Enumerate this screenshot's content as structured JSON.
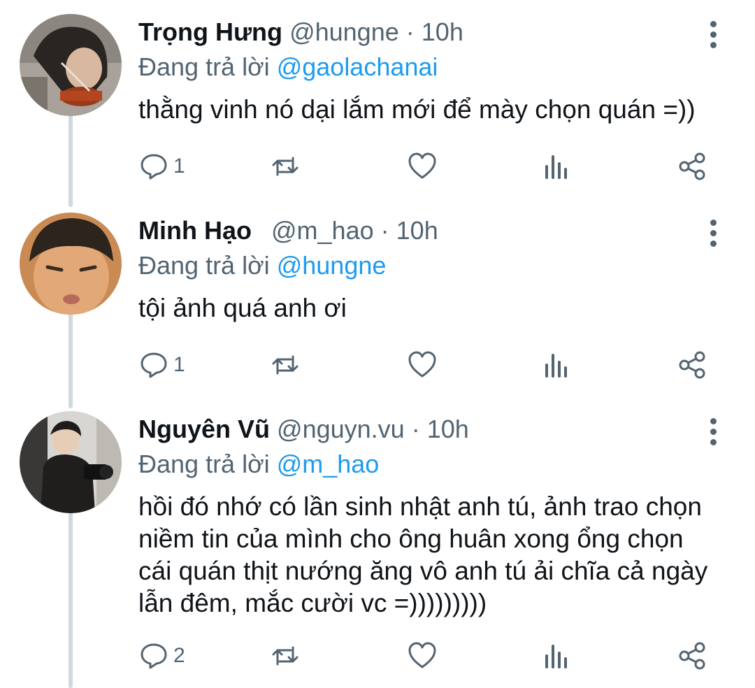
{
  "tweets": [
    {
      "name": "Trọng Hưng",
      "handle": "@hungne",
      "sep": "·",
      "time": "10h",
      "replying_prefix": "Đang trả lời",
      "replying_to": "@gaolachanai",
      "text": "thằng vinh nó dại lắm mới để mày chọn quán =))",
      "reply_count": "1"
    },
    {
      "name": "Minh Hạo",
      "handle": "@m_hao",
      "sep": "·",
      "time": "10h",
      "replying_prefix": "Đang trả lời",
      "replying_to": "@hungne",
      "text": "tội ảnh quá anh ơi",
      "reply_count": "1"
    },
    {
      "name": "Nguyên Vũ",
      "handle": "@nguyn.vu",
      "sep": "·",
      "time": "10h",
      "replying_prefix": "Đang trả lời",
      "replying_to": "@m_hao",
      "text": "hồi đó nhớ có lần sinh nhật anh tú, ảnh trao chọn niềm tin của mình cho ông huân xong ổng chọn cái quán thịt nướng ăng vô anh tú ải chĩa cả ngày lẫn đêm, mắc cười vc =)))))))))",
      "reply_count": "2"
    }
  ],
  "icons": [
    "reply-icon",
    "retweet-icon",
    "like-icon",
    "views-icon",
    "share-icon",
    "more-icon"
  ],
  "colors": {
    "text": "#0f1419",
    "secondary": "#536471",
    "link": "#1d9bf0",
    "thread_line": "#cfd9de"
  }
}
